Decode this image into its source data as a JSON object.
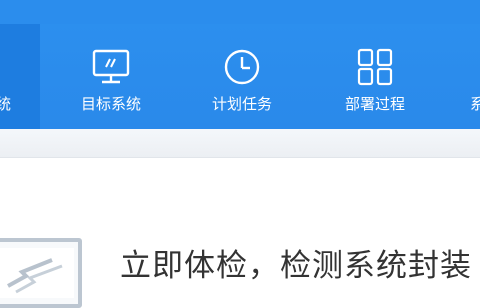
{
  "toolbar": {
    "tabs": [
      {
        "label": "统",
        "icon": "system-icon",
        "active": true
      },
      {
        "label": "目标系统",
        "icon": "monitor-icon",
        "active": false
      },
      {
        "label": "计划任务",
        "icon": "clock-icon",
        "active": false
      },
      {
        "label": "部署过程",
        "icon": "grid-icon",
        "active": false
      },
      {
        "label": "系",
        "icon": "system-icon",
        "active": false
      }
    ]
  },
  "main": {
    "headline": "立即体检，检测系统封装"
  },
  "colors": {
    "toolbar_blue": "#2a89ea",
    "active_tab": "#1e7de0",
    "headline_text": "#333333"
  }
}
